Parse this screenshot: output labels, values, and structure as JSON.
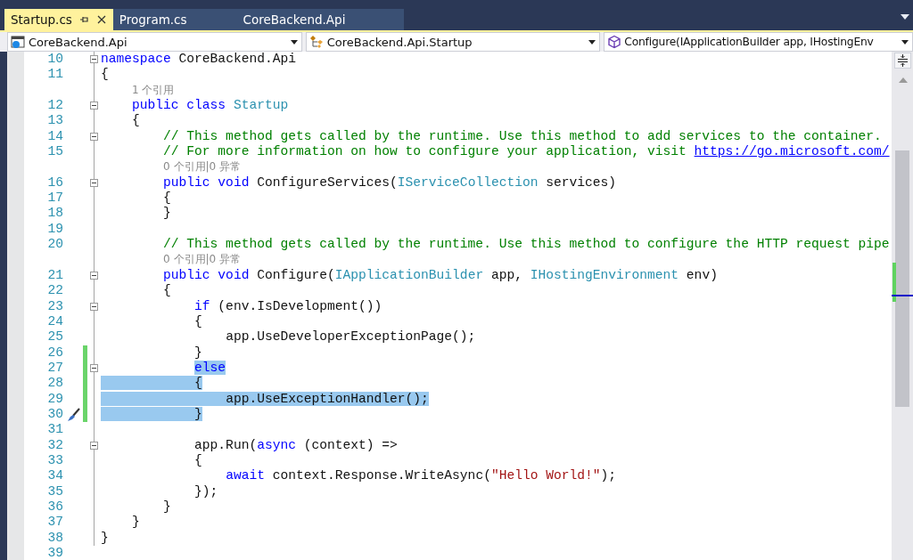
{
  "tabs": [
    {
      "label": "Startup.cs",
      "selected": true
    },
    {
      "label": "Program.cs",
      "selected": false
    },
    {
      "label": "CoreBackend.Api",
      "selected": false
    }
  ],
  "navigation": [
    {
      "kind": "project",
      "label": "CoreBackend.Api"
    },
    {
      "kind": "class",
      "label": "CoreBackend.Api.Startup"
    },
    {
      "kind": "method",
      "label": "Configure(IApplicationBuilder app, IHostingEnv"
    }
  ],
  "lines": [
    {
      "kind": "code",
      "number": "10",
      "fold": true,
      "changed": false,
      "quick_action": false,
      "selected": false,
      "margin_selected": false,
      "tokens": [
        {
          "kind": "keyword",
          "text": "namespace"
        },
        {
          "kind": "plain",
          "text": " CoreBackend.Api"
        }
      ]
    },
    {
      "kind": "code",
      "number": "11",
      "fold": false,
      "changed": false,
      "quick_action": false,
      "selected": false,
      "margin_selected": false,
      "tokens": [
        {
          "kind": "plain",
          "text": "{"
        }
      ]
    },
    {
      "kind": "lens",
      "text": "1 个引用"
    },
    {
      "kind": "code",
      "number": "12",
      "fold": true,
      "changed": false,
      "quick_action": false,
      "selected": false,
      "margin_selected": false,
      "tokens": [
        {
          "kind": "keyword",
          "text": "    public class"
        },
        {
          "kind": "type",
          "text": " Startup"
        }
      ]
    },
    {
      "kind": "code",
      "number": "13",
      "fold": false,
      "changed": false,
      "quick_action": false,
      "selected": false,
      "margin_selected": false,
      "tokens": [
        {
          "kind": "plain",
          "text": "    {"
        }
      ]
    },
    {
      "kind": "code",
      "number": "14",
      "fold": true,
      "changed": false,
      "quick_action": false,
      "selected": false,
      "margin_selected": false,
      "tokens": [
        {
          "kind": "comment",
          "text": "        // This method gets called by the runtime. Use this method to add services to the container."
        }
      ]
    },
    {
      "kind": "code",
      "number": "15",
      "fold": false,
      "changed": false,
      "quick_action": false,
      "selected": false,
      "margin_selected": false,
      "tokens": [
        {
          "kind": "comment",
          "text": "        // For more information on how to configure your application, visit "
        },
        {
          "kind": "link",
          "text": "https://go.microsoft.com/"
        }
      ]
    },
    {
      "kind": "lens",
      "text": "0 个引用|0 异常"
    },
    {
      "kind": "code",
      "number": "16",
      "fold": true,
      "changed": false,
      "quick_action": false,
      "selected": false,
      "margin_selected": false,
      "tokens": [
        {
          "kind": "keyword",
          "text": "        public void"
        },
        {
          "kind": "plain",
          "text": " ConfigureServices("
        },
        {
          "kind": "type",
          "text": "IServiceCollection"
        },
        {
          "kind": "plain",
          "text": " services)"
        }
      ]
    },
    {
      "kind": "code",
      "number": "17",
      "fold": false,
      "changed": false,
      "quick_action": false,
      "selected": false,
      "margin_selected": false,
      "tokens": [
        {
          "kind": "plain",
          "text": "        {"
        }
      ]
    },
    {
      "kind": "code",
      "number": "18",
      "fold": false,
      "changed": false,
      "quick_action": false,
      "selected": false,
      "margin_selected": false,
      "tokens": [
        {
          "kind": "plain",
          "text": "        }"
        }
      ]
    },
    {
      "kind": "code",
      "number": "19",
      "fold": false,
      "changed": false,
      "quick_action": false,
      "selected": false,
      "margin_selected": false
    },
    {
      "kind": "code",
      "number": "20",
      "fold": false,
      "changed": false,
      "quick_action": false,
      "selected": false,
      "margin_selected": false,
      "tokens": [
        {
          "kind": "comment",
          "text": "        // This method gets called by the runtime. Use this method to configure the HTTP request pipe"
        }
      ]
    },
    {
      "kind": "lens",
      "text": "0 个引用|0 异常"
    },
    {
      "kind": "code",
      "number": "21",
      "fold": true,
      "changed": false,
      "quick_action": false,
      "selected": false,
      "margin_selected": false,
      "tokens": [
        {
          "kind": "keyword",
          "text": "        public void"
        },
        {
          "kind": "plain",
          "text": " Configure("
        },
        {
          "kind": "type",
          "text": "IApplicationBuilder"
        },
        {
          "kind": "plain",
          "text": " app, "
        },
        {
          "kind": "type",
          "text": "IHostingEnvironment"
        },
        {
          "kind": "plain",
          "text": " env)"
        }
      ]
    },
    {
      "kind": "code",
      "number": "22",
      "fold": false,
      "changed": false,
      "quick_action": false,
      "selected": false,
      "margin_selected": false,
      "tokens": [
        {
          "kind": "plain",
          "text": "        {"
        }
      ]
    },
    {
      "kind": "code",
      "number": "23",
      "fold": true,
      "changed": false,
      "quick_action": false,
      "selected": false,
      "margin_selected": false,
      "tokens": [
        {
          "kind": "keyword",
          "text": "            if"
        },
        {
          "kind": "plain",
          "text": " (env.IsDevelopment())"
        }
      ]
    },
    {
      "kind": "code",
      "number": "24",
      "fold": false,
      "changed": false,
      "quick_action": false,
      "selected": false,
      "margin_selected": false,
      "tokens": [
        {
          "kind": "plain",
          "text": "            {"
        }
      ]
    },
    {
      "kind": "code",
      "number": "25",
      "fold": false,
      "changed": false,
      "quick_action": false,
      "selected": false,
      "margin_selected": false,
      "tokens": [
        {
          "kind": "plain",
          "text": "                app.UseDeveloperExceptionPage();"
        }
      ]
    },
    {
      "kind": "code",
      "number": "26",
      "fold": false,
      "changed": true,
      "quick_action": false,
      "selected": false,
      "margin_selected": false,
      "tokens": [
        {
          "kind": "plain",
          "text": "            }"
        }
      ]
    },
    {
      "kind": "code",
      "number": "27",
      "fold": true,
      "changed": true,
      "quick_action": false,
      "selected": true,
      "margin_selected": false,
      "tokens": [
        {
          "kind": "keyword",
          "text": "            else"
        }
      ]
    },
    {
      "kind": "code",
      "number": "28",
      "fold": false,
      "changed": true,
      "quick_action": false,
      "selected": true,
      "margin_selected": true,
      "tokens": [
        {
          "kind": "plain",
          "text": "            {"
        }
      ]
    },
    {
      "kind": "code",
      "number": "29",
      "fold": false,
      "changed": true,
      "quick_action": false,
      "selected": true,
      "margin_selected": true,
      "tokens": [
        {
          "kind": "plain",
          "text": "                app.UseExceptionHandler();"
        }
      ]
    },
    {
      "kind": "code",
      "number": "30",
      "fold": false,
      "changed": true,
      "quick_action": true,
      "selected": true,
      "margin_selected": true,
      "tokens": [
        {
          "kind": "plain",
          "text": "            }"
        }
      ]
    },
    {
      "kind": "code",
      "number": "31",
      "fold": false,
      "changed": false,
      "quick_action": false,
      "selected": false,
      "margin_selected": false
    },
    {
      "kind": "code",
      "number": "32",
      "fold": true,
      "changed": false,
      "quick_action": false,
      "selected": false,
      "margin_selected": false,
      "tokens": [
        {
          "kind": "plain",
          "text": "            app.Run("
        },
        {
          "kind": "keyword",
          "text": "async"
        },
        {
          "kind": "plain",
          "text": " (context) =>"
        }
      ]
    },
    {
      "kind": "code",
      "number": "33",
      "fold": false,
      "changed": false,
      "quick_action": false,
      "selected": false,
      "margin_selected": false,
      "tokens": [
        {
          "kind": "plain",
          "text": "            {"
        }
      ]
    },
    {
      "kind": "code",
      "number": "34",
      "fold": false,
      "changed": false,
      "quick_action": false,
      "selected": false,
      "margin_selected": false,
      "tokens": [
        {
          "kind": "keyword",
          "text": "                await"
        },
        {
          "kind": "plain",
          "text": " context.Response.WriteAsync("
        },
        {
          "kind": "string",
          "text": "\"Hello World!\""
        },
        {
          "kind": "plain",
          "text": ");"
        }
      ]
    },
    {
      "kind": "code",
      "number": "35",
      "fold": false,
      "changed": false,
      "quick_action": false,
      "selected": false,
      "margin_selected": false,
      "tokens": [
        {
          "kind": "plain",
          "text": "            });"
        }
      ]
    },
    {
      "kind": "code",
      "number": "36",
      "fold": false,
      "changed": false,
      "quick_action": false,
      "selected": false,
      "margin_selected": false,
      "tokens": [
        {
          "kind": "plain",
          "text": "        }"
        }
      ]
    },
    {
      "kind": "code",
      "number": "37",
      "fold": false,
      "changed": false,
      "quick_action": false,
      "selected": false,
      "margin_selected": false,
      "tokens": [
        {
          "kind": "plain",
          "text": "    }"
        }
      ]
    },
    {
      "kind": "code",
      "number": "38",
      "fold": false,
      "changed": false,
      "quick_action": false,
      "selected": false,
      "margin_selected": false,
      "tokens": [
        {
          "kind": "plain",
          "text": "}"
        }
      ]
    },
    {
      "kind": "code",
      "number": "39",
      "fold": false,
      "changed": false,
      "quick_action": false,
      "selected": false,
      "margin_selected": false
    }
  ]
}
